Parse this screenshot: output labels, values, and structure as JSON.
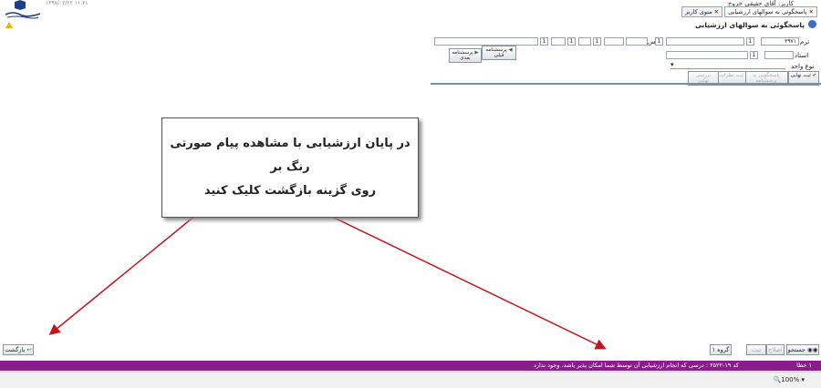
{
  "header": {
    "user_line": "کاربر: آقای حقیقی خروج",
    "date_text": "۱۳۹۷/۰۲/۲۲ ۱۱:۲۱",
    "red_text": "",
    "tabs": [
      {
        "label": "منوی کاربر",
        "active": false
      },
      {
        "label": "پاسخگوئی به سوالهای ارزشیابی",
        "active": true
      }
    ]
  },
  "form": {
    "title": "پاسخگوئی به سوالهای ارزشیابی",
    "term_label": "ترم",
    "term_value": "۳۹۷۱",
    "course_label": "درس",
    "teacher_label": "استاد",
    "unit_label": "نوع واحد",
    "row1_nums": [
      "1",
      "1",
      "1",
      "1",
      "1"
    ],
    "teacher_num": "1",
    "prev_button": "پرسشنامه قبلی",
    "next_button": "پرسشنامه بعدی",
    "action_buttons": [
      "ثبت نهایی",
      "پاسخگویی به پرسشنامه",
      "ثبت نظرات",
      "بررسی نهایی"
    ]
  },
  "callout": {
    "line1": "در پایان ارزشیابی با مشاهده پیام صورتی رنگ بر",
    "line2": "روی گزینه بازگشت کلیک کنید"
  },
  "bottom": {
    "back_button": "بازگشت",
    "search_button": "جستجو",
    "nav_buttons": [
      "گروه ۱",
      "ثبت",
      "اصلاح"
    ],
    "error_count": "۱ خطا",
    "pink_message": "کد ۱۹-۲۵۲۲ : درسی که انجام ارزشیابی آن توسط شما امکان پذیر باشد، وجود ندارد",
    "zoom": "100%"
  },
  "colors": {
    "purple_bar": "#8b1c8c",
    "arrow": "#c0161c",
    "accent": "#3c6fc4"
  }
}
